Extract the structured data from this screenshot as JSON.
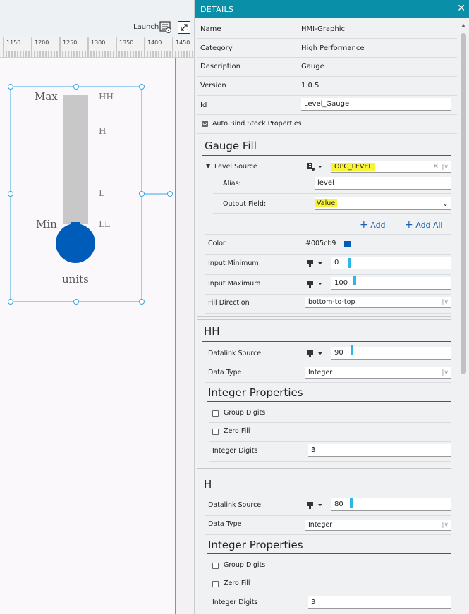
{
  "toolbar": {
    "launch_label": "Launch",
    "launch_icon": "launch-settings-icon",
    "expand_icon": "expand-icon"
  },
  "ruler": {
    "labels": [
      "1150",
      "1200",
      "1250",
      "1300",
      "1350",
      "1400",
      "1450"
    ]
  },
  "gauge": {
    "max_label": "Max",
    "min_label": "Min",
    "units_label": "units",
    "level_labels": [
      "HH",
      "H",
      "L",
      "LL"
    ],
    "fill_color": "#005cb9",
    "track_color": "#c8c8c8",
    "selection_color": "#3aa6e0"
  },
  "details": {
    "title": "DETAILS",
    "close_icon": "close-icon",
    "properties": [
      {
        "label": "Name",
        "value": "HMI-Graphic"
      },
      {
        "label": "Category",
        "value": "High Performance"
      },
      {
        "label": "Description",
        "value": "Gauge"
      },
      {
        "label": "Version",
        "value": "1.0.5"
      }
    ],
    "id_label": "Id",
    "id_value": "Level_Gauge",
    "auto_bind_label": "Auto Bind Stock Properties",
    "auto_bind_checked": true,
    "gauge_fill": {
      "title": "Gauge Fill",
      "level_source_label": "Level Source",
      "level_source_value": "OPC_LEVEL",
      "alias_label": "Alias:",
      "alias_value": "level",
      "output_field_label": "Output Field:",
      "output_field_value": "Value",
      "add_label": "Add",
      "add_all_label": "Add All",
      "color_label": "Color",
      "color_value": "#005cb9",
      "input_min_label": "Input Minimum",
      "input_min_value": "0",
      "input_max_label": "Input Maximum",
      "input_max_value": "100",
      "fill_direction_label": "Fill Direction",
      "fill_direction_value": "bottom-to-top"
    },
    "hh": {
      "title": "HH",
      "datalink_label": "Datalink Source",
      "datalink_value": "90",
      "data_type_label": "Data Type",
      "data_type_value": "Integer",
      "int_props_title": "Integer Properties",
      "group_digits_label": "Group Digits",
      "zero_fill_label": "Zero Fill",
      "integer_digits_label": "Integer Digits",
      "integer_digits_value": "3"
    },
    "h": {
      "title": "H",
      "datalink_label": "Datalink Source",
      "datalink_value": "80",
      "data_type_label": "Data Type",
      "data_type_value": "Integer",
      "int_props_title": "Integer Properties",
      "group_digits_label": "Group Digits",
      "zero_fill_label": "Zero Fill",
      "integer_digits_label": "Integer Digits",
      "integer_digits_value": "3"
    },
    "highlight_color": "#f8f43a",
    "header_color": "#0a8fa8"
  }
}
